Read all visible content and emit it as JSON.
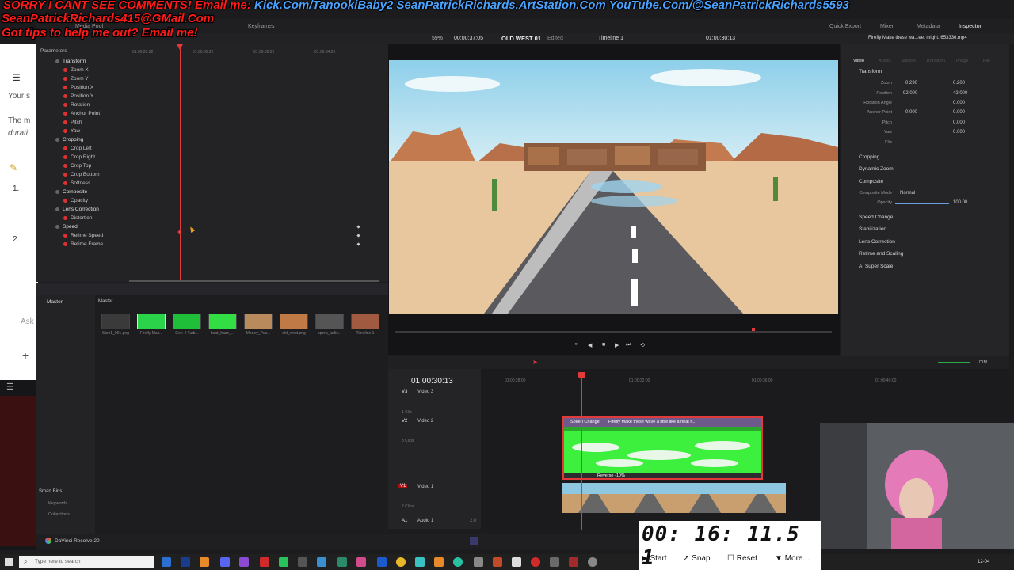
{
  "overlay": {
    "line1_red": "SORRY I CANT SEE COMMENTS! Email me:",
    "line1_links": "Kick.Com/TanookiBaby2 SeanPatrickRichards.ArtStation.Com YouTube.Com/@SeanPatrickRichards5593",
    "line2": "SeanPatrickRichards415@GMail.Com",
    "line3": "Got tips to help me out? Email me!"
  },
  "topbar": {
    "media_pool": "Media Pool",
    "keyframes": "Keyframes",
    "project_title": "OLD WEST 01",
    "edited": "Edited",
    "quick_export": "Quick Export",
    "mixer": "Mixer",
    "metadata": "Metadata",
    "inspector": "Inspector",
    "zoom": "59%",
    "timecode_left": "00:00:37:05",
    "timeline_name": "Timeline 1",
    "timecode_right": "01:00:30:13",
    "clip_name": "Firefly Make these wa...eet might. 653336.mp4"
  },
  "keyframes_panel": {
    "header": "Parameters",
    "ruler": [
      "01:00:28:22",
      "01:00:30:22",
      "01:00:32:22",
      "01:00:34:22"
    ],
    "params": [
      {
        "label": "Transform",
        "group": true
      },
      {
        "label": "Zoom X",
        "group": false
      },
      {
        "label": "Zoom Y",
        "group": false
      },
      {
        "label": "Position X",
        "group": false
      },
      {
        "label": "Position Y",
        "group": false
      },
      {
        "label": "Rotation",
        "group": false
      },
      {
        "label": "Anchor Point",
        "group": false
      },
      {
        "label": "Pitch",
        "group": false
      },
      {
        "label": "Yaw",
        "group": false
      },
      {
        "label": "Cropping",
        "group": true
      },
      {
        "label": "Crop Left",
        "group": false
      },
      {
        "label": "Crop Right",
        "group": false
      },
      {
        "label": "Crop Top",
        "group": false
      },
      {
        "label": "Crop Bottom",
        "group": false
      },
      {
        "label": "Softness",
        "group": false
      },
      {
        "label": "Composite",
        "group": true
      },
      {
        "label": "Opacity",
        "group": false
      },
      {
        "label": "Lens Correction",
        "group": true
      },
      {
        "label": "Distortion",
        "group": false
      },
      {
        "label": "Speed",
        "group": true
      },
      {
        "label": "Retime Speed",
        "group": false
      },
      {
        "label": "Retime Frame",
        "group": false
      }
    ]
  },
  "media_pool": {
    "master_label": "Master",
    "master_header": "Master",
    "smart_bins": "Smart Bins",
    "keywords": "Keywords",
    "collections": "Collections",
    "clips": [
      {
        "label": "Sam1_001.png",
        "color": "#3a3a3a"
      },
      {
        "label": "Firefly Mak...",
        "color": "#2ad34a"
      },
      {
        "label": "Gen-4 Turb...",
        "color": "#1fbf3a"
      },
      {
        "label": "heat_haze_...",
        "color": "#33dd44"
      },
      {
        "label": "Money_Pus...",
        "color": "#b88a5c"
      },
      {
        "label": "old_west.png",
        "color": "#c07a45"
      },
      {
        "label": "opera_ladie...",
        "color": "#555"
      },
      {
        "label": "Timeline 1",
        "color": "#a05a40"
      }
    ]
  },
  "inspector": {
    "tab_video": "Video",
    "tab_audio": "Audio",
    "tab_effects": "Effects",
    "tab_transition": "Transition",
    "tab_image": "Image",
    "tab_file": "File",
    "transform": "Transform",
    "zoom_label": "Zoom",
    "zoom_x": "0.290",
    "zoom_y": "0.200",
    "position_label": "Position",
    "position_x": "92.000",
    "position_y": "-42.000",
    "rotation_label": "Rotation Angle",
    "rotation_val": "0.000",
    "anchor_label": "Anchor Point",
    "anchor_x": "0.000",
    "anchor_y": "0.000",
    "pitch_label": "Pitch",
    "pitch_val": "0.000",
    "yaw_label": "Yaw",
    "yaw_val": "0.000",
    "flip_label": "Flip",
    "cropping": "Cropping",
    "dynamic_zoom": "Dynamic Zoom",
    "composite": "Composite",
    "composite_mode_label": "Composite Mode",
    "composite_mode": "Normal",
    "opacity_label": "Opacity",
    "opacity_val": "100.00",
    "speed_change": "Speed Change",
    "stabilization": "Stabilization",
    "lens_correction": "Lens Correction",
    "retime_scaling": "Retime and Scaling",
    "super_scale": "AI Super Scale"
  },
  "timeline": {
    "timecode": "01:00:30:13",
    "ruler": [
      "01:00:28:00",
      "01:00:32:00",
      "01:00:36:00",
      "01:00:40:00"
    ],
    "v3": "V3",
    "v3_name": "Video 3",
    "v3_clips": "1 Clip",
    "v2": "V2",
    "v2_name": "Video 2",
    "v2_clips": "3 Clips",
    "v1": "V1",
    "v1_name": "Video 1",
    "v1_clips": "2 Clips",
    "a1": "A1",
    "a1_name": "Audio 1",
    "a1_level": "2.0",
    "speed_change_clip": "Speed Change",
    "v2_clip_title": "Firefly Make these wave a little like a heat h...",
    "reverse_label": "Reverse -10%",
    "dim": "DIM"
  },
  "app": {
    "name": "DaVinci Resolve 20"
  },
  "left_browser": {
    "text1": "Your s",
    "text2": "The m",
    "text3": "durati",
    "item1": "1.",
    "item2": "2.",
    "ask": "Ask"
  },
  "taskbar": {
    "search_placeholder": "Type here to search",
    "date": "12-04"
  },
  "timer": {
    "time": "00: 16: 11.5 1",
    "start": "Start",
    "snap": "Snap",
    "reset": "Reset",
    "more": "More..."
  },
  "colors": {
    "playhead": "#e23a3a",
    "green_clip": "#3ef03e",
    "resolve_bg": "#1c1c1e",
    "panel_bg": "#28282b"
  }
}
